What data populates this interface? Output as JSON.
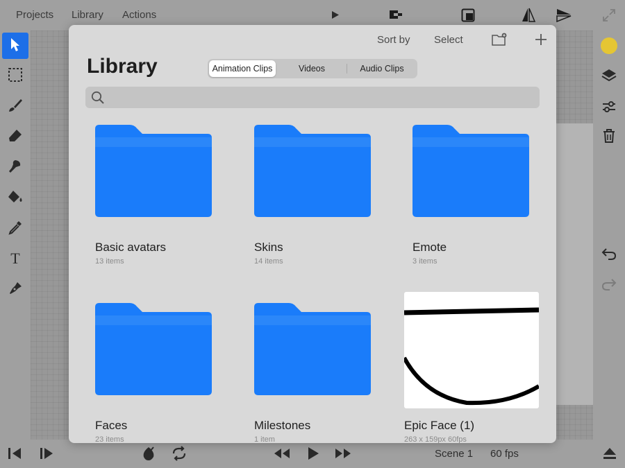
{
  "topbar": {
    "menus": [
      "Projects",
      "Library",
      "Actions"
    ]
  },
  "library": {
    "title": "Library",
    "sort_label": "Sort by",
    "select_label": "Select",
    "tabs": [
      "Animation Clips",
      "Videos",
      "Audio Clips"
    ],
    "active_tab": "Animation Clips",
    "search": {
      "value": "",
      "placeholder": ""
    },
    "items": [
      {
        "name": "Basic avatars",
        "meta": "13 items",
        "kind": "folder"
      },
      {
        "name": "Skins",
        "meta": "14 items",
        "kind": "folder"
      },
      {
        "name": "Emote",
        "meta": "3 items",
        "kind": "folder"
      },
      {
        "name": "Faces",
        "meta": "23 items",
        "kind": "folder"
      },
      {
        "name": "Milestones",
        "meta": "1 item",
        "kind": "folder"
      },
      {
        "name": "Epic Face (1)",
        "meta": "263 x 159px 60fps",
        "kind": "clip"
      }
    ]
  },
  "bottombar": {
    "scene": "Scene 1",
    "fps": "60 fps"
  },
  "colors": {
    "accent": "#1d6fe8",
    "folder": "#1a7cfa",
    "current_color": "#e5c634",
    "modal_bg": "#d9d9d9"
  },
  "icons": [
    "play-icon",
    "clip-logo-icon",
    "frame-icon",
    "flip-horizontal-icon",
    "flip-vertical-icon",
    "expand-icon",
    "select-arrow-icon",
    "marquee-select-icon",
    "brush-icon",
    "eraser-icon",
    "smudge-icon",
    "fill-bucket-icon",
    "eyedropper-icon",
    "text-tool-icon",
    "pen-tool-icon",
    "color-swatch-icon",
    "layers-icon",
    "adjustments-icon",
    "trash-icon",
    "undo-icon",
    "redo-icon",
    "search-icon",
    "new-folder-icon",
    "add-icon",
    "step-backward-icon",
    "step-forward-icon",
    "onion-skin-icon",
    "loop-icon",
    "rewind-icon",
    "play-icon",
    "fast-forward-icon",
    "eject-icon"
  ]
}
